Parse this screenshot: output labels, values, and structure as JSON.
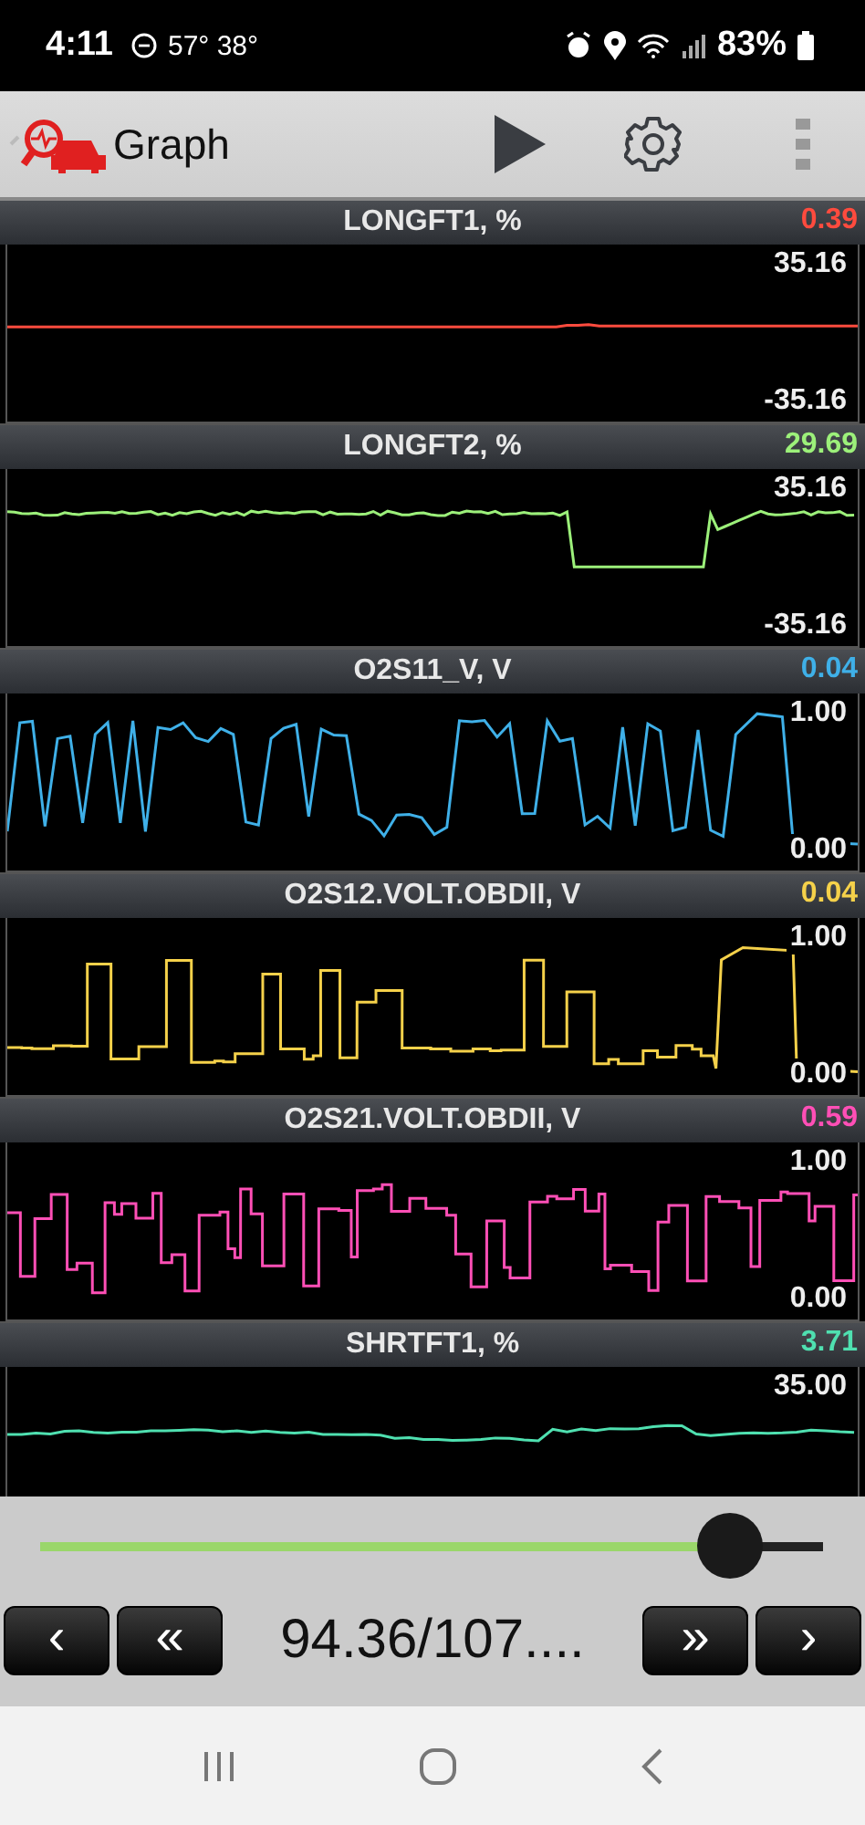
{
  "status_bar": {
    "time": "4:11",
    "weather": "57° 38°",
    "battery": "83%"
  },
  "toolbar": {
    "title": "Graph"
  },
  "panels": [
    {
      "title": "LONGFT1, %",
      "value": "0.39",
      "color": "#ff4b3e",
      "top_label": "35.16",
      "bottom_label": "-35.16"
    },
    {
      "title": "LONGFT2, %",
      "value": "29.69",
      "color": "#9cf07a",
      "top_label": "35.16",
      "bottom_label": "-35.16"
    },
    {
      "title": "O2S11_V, V",
      "value": "0.04",
      "color": "#3fb0e8",
      "top_label": "1.00",
      "bottom_label": "0.00"
    },
    {
      "title": "O2S12.VOLT.OBDII, V",
      "value": "0.04",
      "color": "#f5d14a",
      "top_label": "1.00",
      "bottom_label": "0.00"
    },
    {
      "title": "O2S21.VOLT.OBDII, V",
      "value": "0.59",
      "color": "#ff4fb6",
      "top_label": "1.00",
      "bottom_label": "0.00"
    },
    {
      "title": "SHRTFT1, %",
      "value": "3.71",
      "color": "#4fe0b0",
      "top_label": "35.00"
    }
  ],
  "navigation": {
    "prev": "‹",
    "rewind": "«",
    "position": "94.36/107....",
    "forward": "»",
    "next": "›"
  }
}
